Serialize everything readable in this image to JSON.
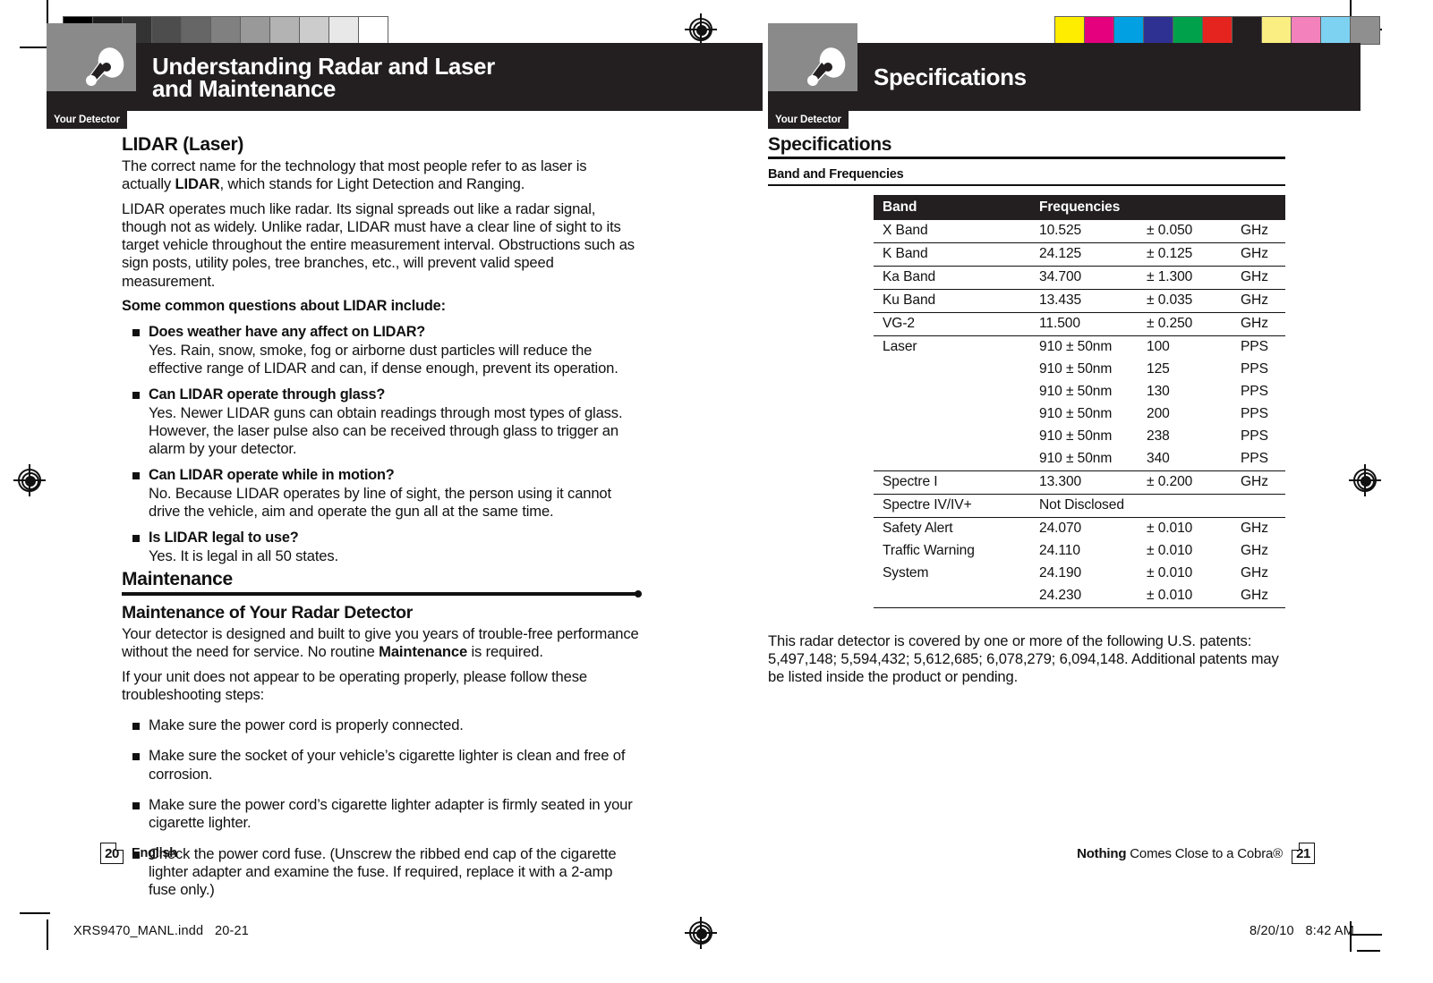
{
  "document": {
    "filename": "XRS9470_MANL.indd",
    "page_range": "20-21",
    "print_date": "8/20/10",
    "print_time": "8:42 AM"
  },
  "left_page": {
    "header": {
      "title_line1": "Understanding Radar and Laser",
      "title_line2": "and Maintenance",
      "detector_tab": "Your Detector"
    },
    "lidar": {
      "heading": "LIDAR (Laser)",
      "para1_a": "The correct name for the technology that most people refer to as laser is actually ",
      "para1_bold": "LIDAR",
      "para1_b": ", which stands for Light Detection and Ranging.",
      "para2": "LIDAR operates much like radar. Its signal spreads out like a radar signal, though not as widely. Unlike radar, LIDAR must have a clear line of sight to its target vehicle throughout the entire measurement interval. Obstructions such as sign posts, utility poles, tree branches, etc., will prevent valid speed measurement.",
      "lead_in": "Some common questions about LIDAR include:",
      "faq": [
        {
          "question": "Does weather have any affect on LIDAR?",
          "answer": "Yes. Rain, snow, smoke, fog or airborne dust particles will reduce the effective range of LIDAR and can, if dense enough, prevent its operation."
        },
        {
          "question": "Can LIDAR operate through glass?",
          "answer": "Yes. Newer LIDAR guns can obtain readings through most types of glass. However, the laser pulse also can be received through glass to trigger an alarm by your detector."
        },
        {
          "question": "Can LIDAR operate while in motion?",
          "answer": "No. Because LIDAR operates by line of sight, the person using it cannot drive the vehicle, aim and operate the gun all at the same time."
        },
        {
          "question": "Is LIDAR legal to use?",
          "answer": "Yes. It is legal in all 50 states."
        }
      ]
    },
    "maintenance": {
      "section_heading": "Maintenance",
      "sub_heading": "Maintenance of Your Radar Detector",
      "para1_a": "Your detector is designed and built to give you years of trouble-free performance without the need for service. No routine ",
      "para1_bold": "Maintenance",
      "para1_b": " is required.",
      "para2": "If your unit does not appear to be operating properly, please follow these troubleshooting steps:",
      "steps": [
        "Make sure the power cord is properly connected.",
        "Make sure the socket of your vehicle’s cigarette lighter is clean and free of corrosion.",
        "Make sure the power cord’s cigarette lighter adapter is firmly seated in your cigarette lighter.",
        "Check the power cord fuse. (Unscrew the ribbed end cap of the cigarette lighter adapter and examine the fuse. If required, replace it with a 2-amp fuse only.)"
      ]
    },
    "footer": {
      "page_number": "20",
      "language": "English"
    }
  },
  "right_page": {
    "header": {
      "title": "Specifications",
      "detector_tab": "Your Detector"
    },
    "specs": {
      "heading": "Specifications",
      "caption": "Band and Frequencies",
      "columns": [
        "Band",
        "Frequencies"
      ],
      "rows": [
        {
          "band": "X Band",
          "freq": "10.525",
          "tol": "± 0.050",
          "unit": "GHz",
          "rule": "bordered"
        },
        {
          "band": "K Band",
          "freq": "24.125",
          "tol": "± 0.125",
          "unit": "GHz",
          "rule": "bordered"
        },
        {
          "band": "Ka Band",
          "freq": "34.700",
          "tol": "± 1.300",
          "unit": "GHz",
          "rule": "bordered"
        },
        {
          "band": "Ku Band",
          "freq": "13.435",
          "tol": "± 0.035",
          "unit": "GHz",
          "rule": "bordered"
        },
        {
          "band": "VG-2",
          "freq": "11.500",
          "tol": "± 0.250",
          "unit": "GHz",
          "rule": "bordered"
        },
        {
          "band": "Laser",
          "freq": "910 ± 50nm",
          "tol": "100",
          "unit": "PPS",
          "rule": "none"
        },
        {
          "band": "",
          "freq": "910 ± 50nm",
          "tol": "125",
          "unit": "PPS",
          "rule": "none"
        },
        {
          "band": "",
          "freq": "910 ± 50nm",
          "tol": "130",
          "unit": "PPS",
          "rule": "none"
        },
        {
          "band": "",
          "freq": "910 ± 50nm",
          "tol": "200",
          "unit": "PPS",
          "rule": "none"
        },
        {
          "band": "",
          "freq": "910 ± 50nm",
          "tol": "238",
          "unit": "PPS",
          "rule": "none"
        },
        {
          "band": "",
          "freq": "910 ± 50nm",
          "tol": "340",
          "unit": "PPS",
          "rule": "bordered"
        },
        {
          "band": "Spectre I",
          "freq": "13.300",
          "tol": "± 0.200",
          "unit": "GHz",
          "rule": "bordered"
        },
        {
          "band": "Spectre IV/IV+",
          "freq": "Not Disclosed",
          "tol": "",
          "unit": "",
          "rule": "bordered"
        },
        {
          "band": "Safety Alert",
          "freq": "24.070",
          "tol": "± 0.010",
          "unit": "GHz",
          "rule": "none"
        },
        {
          "band": "Traffic Warning",
          "freq": "24.110",
          "tol": "± 0.010",
          "unit": "GHz",
          "rule": "none"
        },
        {
          "band": "System",
          "freq": "24.190",
          "tol": "± 0.010",
          "unit": "GHz",
          "rule": "none"
        },
        {
          "band": "",
          "freq": "24.230",
          "tol": "± 0.010",
          "unit": "GHz",
          "rule": "groupend"
        }
      ]
    },
    "patents": "This radar detector is covered by one or more of the following U.S. patents: 5,497,148; 5,594,432; 5,612,685; 6,078,279; 6,094,148. Additional patents may be listed inside the product or pending.",
    "footer": {
      "tagline_bold": "Nothing",
      "tagline_rest": " Comes Close to a Cobra®",
      "page_number": "21"
    }
  },
  "color_bars": {
    "grayscale": [
      "#000000",
      "#1d1d1d",
      "#333333",
      "#4d4d4d",
      "#666666",
      "#808080",
      "#999999",
      "#b3b3b3",
      "#cccccc",
      "#e8e8e8",
      "#ffffff"
    ],
    "process": [
      "#ffed00",
      "#e5007e",
      "#00a0e3",
      "#2e3192",
      "#00a14b",
      "#e52420",
      "#231f20",
      "#faee82",
      "#f381bb",
      "#7dd2f2",
      "#8f8f8f"
    ]
  }
}
